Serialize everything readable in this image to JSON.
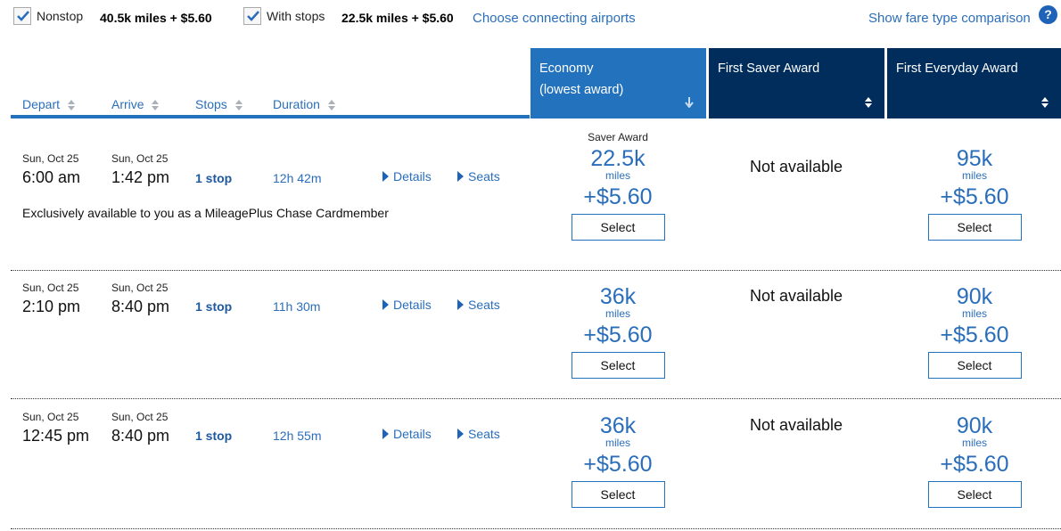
{
  "filters": {
    "nonstop": {
      "label": "Nonstop",
      "checked": true,
      "price": "40.5k miles + $5.60"
    },
    "with_stops": {
      "label": "With stops",
      "checked": true,
      "price": "22.5k miles + $5.60"
    },
    "connecting_link": "Choose connecting airports",
    "comparison_link": "Show fare type comparison",
    "help_icon": "?"
  },
  "columns": {
    "sort_headers": [
      "Depart",
      "Arrive",
      "Stops",
      "Duration"
    ],
    "fare_headers": [
      {
        "line1": "Economy",
        "line2": "(lowest award)",
        "sort": "descending",
        "active": true
      },
      {
        "line1": "First Saver Award",
        "line2": "",
        "sort": "none",
        "active": false
      },
      {
        "line1": "First Everyday Award",
        "line2": "",
        "sort": "none",
        "active": false
      }
    ]
  },
  "colors": {
    "active_header": "#2272be",
    "inactive_header": "#002d5b",
    "link": "#2a6ebb"
  },
  "flights": [
    {
      "depart_date": "Sun, Oct 25",
      "depart_time": "6:00 am",
      "arrive_date": "Sun, Oct 25",
      "arrive_time": "1:42 pm",
      "stops": "1 stop",
      "duration": "12h 42m",
      "details_label": "Details",
      "seats_label": "Seats",
      "promo": "Exclusively available to you as a MileagePlus Chase Cardmember",
      "economy": {
        "badge": "Saver Award",
        "miles": "22.5k",
        "miles_unit": "miles",
        "tax": "+$5.60",
        "select_label": "Select"
      },
      "first_saver": {
        "status": "Not available"
      },
      "first_everyday": {
        "miles": "95k",
        "miles_unit": "miles",
        "tax": "+$5.60",
        "select_label": "Select"
      }
    },
    {
      "depart_date": "Sun, Oct 25",
      "depart_time": "2:10 pm",
      "arrive_date": "Sun, Oct 25",
      "arrive_time": "8:40 pm",
      "stops": "1 stop",
      "duration": "11h 30m",
      "details_label": "Details",
      "seats_label": "Seats",
      "economy": {
        "miles": "36k",
        "miles_unit": "miles",
        "tax": "+$5.60",
        "select_label": "Select"
      },
      "first_saver": {
        "status": "Not available"
      },
      "first_everyday": {
        "miles": "90k",
        "miles_unit": "miles",
        "tax": "+$5.60",
        "select_label": "Select"
      }
    },
    {
      "depart_date": "Sun, Oct 25",
      "depart_time": "12:45 pm",
      "arrive_date": "Sun, Oct 25",
      "arrive_time": "8:40 pm",
      "stops": "1 stop",
      "duration": "12h 55m",
      "details_label": "Details",
      "seats_label": "Seats",
      "economy": {
        "miles": "36k",
        "miles_unit": "miles",
        "tax": "+$5.60",
        "select_label": "Select"
      },
      "first_saver": {
        "status": "Not available"
      },
      "first_everyday": {
        "miles": "90k",
        "miles_unit": "miles",
        "tax": "+$5.60",
        "select_label": "Select"
      }
    }
  ]
}
